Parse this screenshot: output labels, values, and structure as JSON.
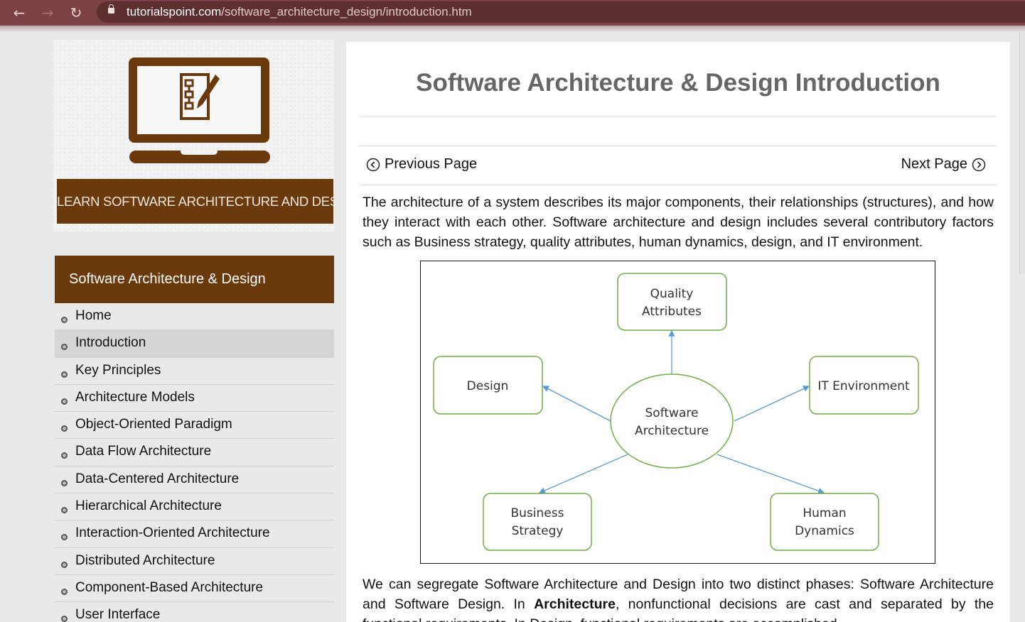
{
  "browser": {
    "back_icon": "arrow-left-icon",
    "forward_icon": "arrow-right-icon",
    "reload_icon": "reload-icon",
    "url_domain": "tutorialspoint.com",
    "url_path": "/software_architecture_design/introduction.htm"
  },
  "sidebar": {
    "banner_text": "LEARN SOFTWARE ARCHITECTURE AND DESIGN",
    "menu_title": "Software Architecture & Design",
    "items": [
      {
        "label": "Home"
      },
      {
        "label": "Introduction"
      },
      {
        "label": "Key Principles"
      },
      {
        "label": "Architecture Models"
      },
      {
        "label": "Object-Oriented Paradigm"
      },
      {
        "label": "Data Flow Architecture"
      },
      {
        "label": "Data-Centered Architecture"
      },
      {
        "label": "Hierarchical Architecture"
      },
      {
        "label": "Interaction-Oriented Architecture"
      },
      {
        "label": "Distributed Architecture"
      },
      {
        "label": "Component-Based Architecture"
      },
      {
        "label": "User Interface"
      }
    ],
    "active_item": "Introduction"
  },
  "main": {
    "title": "Software Architecture & Design Introduction",
    "prev_label": "Previous Page",
    "next_label": "Next Page",
    "paragraph1": "The architecture of a system describes its major components, their relationships (structures), and how they interact with each other. Software architecture and design includes several contributory factors such as Business strategy, quality attributes, human dynamics, design, and IT environment.",
    "paragraph2_start": "We can segregate Software Architecture and Design into two distinct phases: Software Architecture and Software Design. In ",
    "paragraph2_emphasis": "Architecture",
    "paragraph2_end": ", nonfunctional decisions are cast and separated by the functional requirements. In Design, functional requirements are accomplished."
  },
  "diagram": {
    "center": [
      "Software",
      "Architecture"
    ],
    "quality": [
      "Quality",
      "Attributes"
    ],
    "design": [
      "Design"
    ],
    "it_environment": [
      "IT Environment"
    ],
    "business": [
      "Business",
      "Strategy"
    ],
    "human": [
      "Human",
      "Dynamics"
    ],
    "box_border_color": "#70ad47",
    "arrow_color": "#5b9bd5"
  },
  "colors": {
    "brand_brown": "#6b3a0c",
    "browser_bar": "#7c4144"
  }
}
